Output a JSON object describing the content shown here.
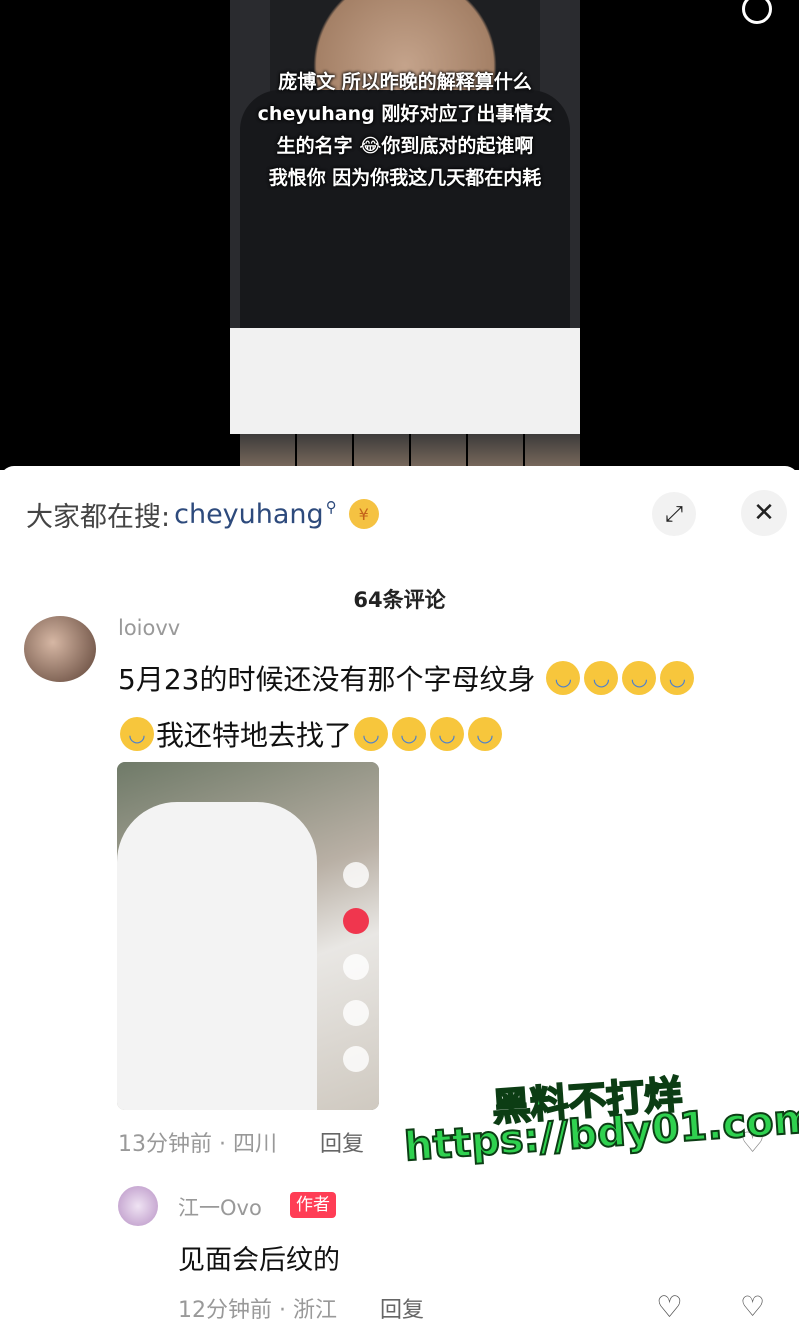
{
  "video": {
    "caption_line1": "庞博文 所以昨晚的解释算什么",
    "caption_line2": "cheyuhang 刚好对应了出事情女",
    "caption_line3": "生的名字 😂你到底对的起谁啊",
    "caption_line4": "我恨你 因为你我这几天都在内耗"
  },
  "search": {
    "label": "大家都在搜:",
    "term": "cheyuhang",
    "term_icon": "search-icon",
    "coin": "¥"
  },
  "comments_header": "64条评论",
  "comments": [
    {
      "user": "loiovv",
      "text_line1": "5月23的时候还没有那个字母纹身",
      "text_line2": "我还特地去找了",
      "emoji": "crying-face",
      "time": "13分钟前",
      "location": "四川",
      "reply": "回复"
    },
    {
      "user": "江一Ovo",
      "badge": "作者",
      "text": "见面会后纹的",
      "time": "12分钟前",
      "location": "浙江",
      "reply": "回复"
    }
  ],
  "watermark": {
    "line1": "黑料不打烊",
    "line2": "https://bdy01.com"
  },
  "colors": {
    "accent_link": "#2d4a7c",
    "badge_red": "#ff3d55",
    "watermark_green": "#2fd14f"
  }
}
